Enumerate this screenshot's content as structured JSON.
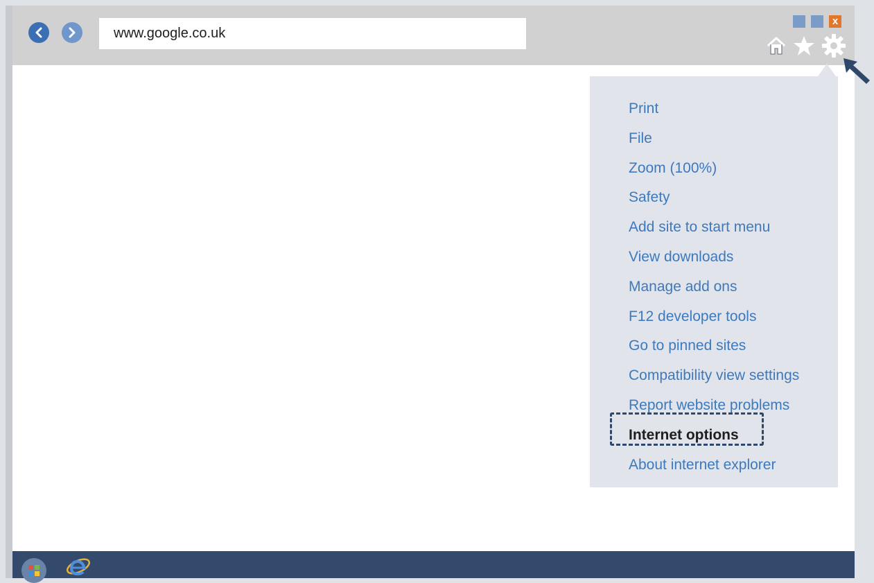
{
  "browser": {
    "address": "www.google.co.uk",
    "close_label": "x",
    "accent_color": "#3a6fb4"
  },
  "toolbar": {
    "icons": [
      "home-icon",
      "star-icon",
      "gear-icon"
    ]
  },
  "menu": {
    "items": [
      "Print",
      "File",
      "Zoom (100%)",
      "Safety",
      "Add site to start menu",
      "View downloads",
      "Manage add ons",
      "F12 developer tools",
      "Go to pinned sites",
      "Compatibility view settings",
      "Report website problems",
      "Internet options",
      "About internet explorer"
    ],
    "highlighted": "Internet options"
  },
  "taskbar": {
    "icons": [
      "windows-start-icon",
      "internet-explorer-icon"
    ]
  }
}
